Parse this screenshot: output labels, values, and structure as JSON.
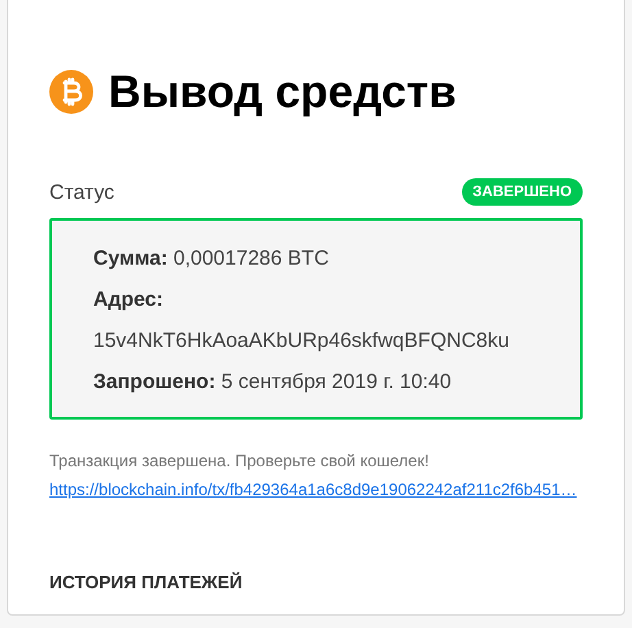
{
  "title": "Вывод средств",
  "status": {
    "label": "Статус",
    "badge": "ЗАВЕРШЕНО"
  },
  "details": [
    {
      "label": "Сумма:",
      "value": "0,00017286 BTC",
      "kind": "inline"
    },
    {
      "label": "Адрес:",
      "value": "15v4NkT6HkAoaAKbURp46skfwqBFQNC8ku",
      "kind": "stacked"
    },
    {
      "label": "Запрошено:",
      "value": "5 сентября 2019 г. 10:40",
      "kind": "inline"
    }
  ],
  "message": "Транзакция завершена. Проверьте свой кошелек!",
  "link": "https://blockchain.info/tx/fb429364a1a6c8d9e19062242af211c2f6b451…",
  "history_heading": "ИСТОРИЯ ПЛАТЕЖЕЙ"
}
